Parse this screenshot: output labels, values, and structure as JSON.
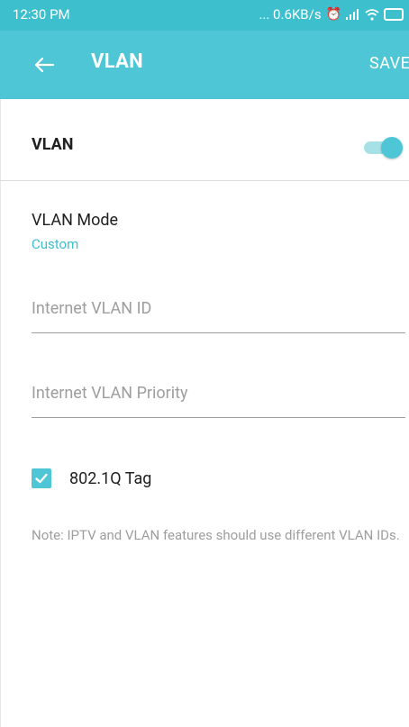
{
  "status_bar": {
    "time": "12:30 PM",
    "network_speed": "... 0.6KB/s",
    "icons": [
      "alarm-icon",
      "signal-icon",
      "wifi-icon",
      "battery-icon"
    ]
  },
  "app_bar": {
    "back_icon": "arrow-left-icon",
    "title": "VLAN",
    "save_label": "SAVE"
  },
  "vlan_toggle": {
    "label": "VLAN",
    "enabled": true
  },
  "vlan_mode": {
    "label": "VLAN Mode",
    "value": "Custom"
  },
  "fields": {
    "internet_vlan_id": {
      "value": "",
      "placeholder": "Internet VLAN ID"
    },
    "internet_vlan_priority": {
      "value": "",
      "placeholder": "Internet VLAN Priority"
    }
  },
  "tag_checkbox": {
    "label": "802.1Q Tag",
    "checked": true
  },
  "note": "Note: IPTV and VLAN features should use different VLAN IDs.",
  "colors": {
    "accent": "#4ec6d5",
    "status_bar": "#3dbfce",
    "hint_text": "#9e9e9e"
  }
}
